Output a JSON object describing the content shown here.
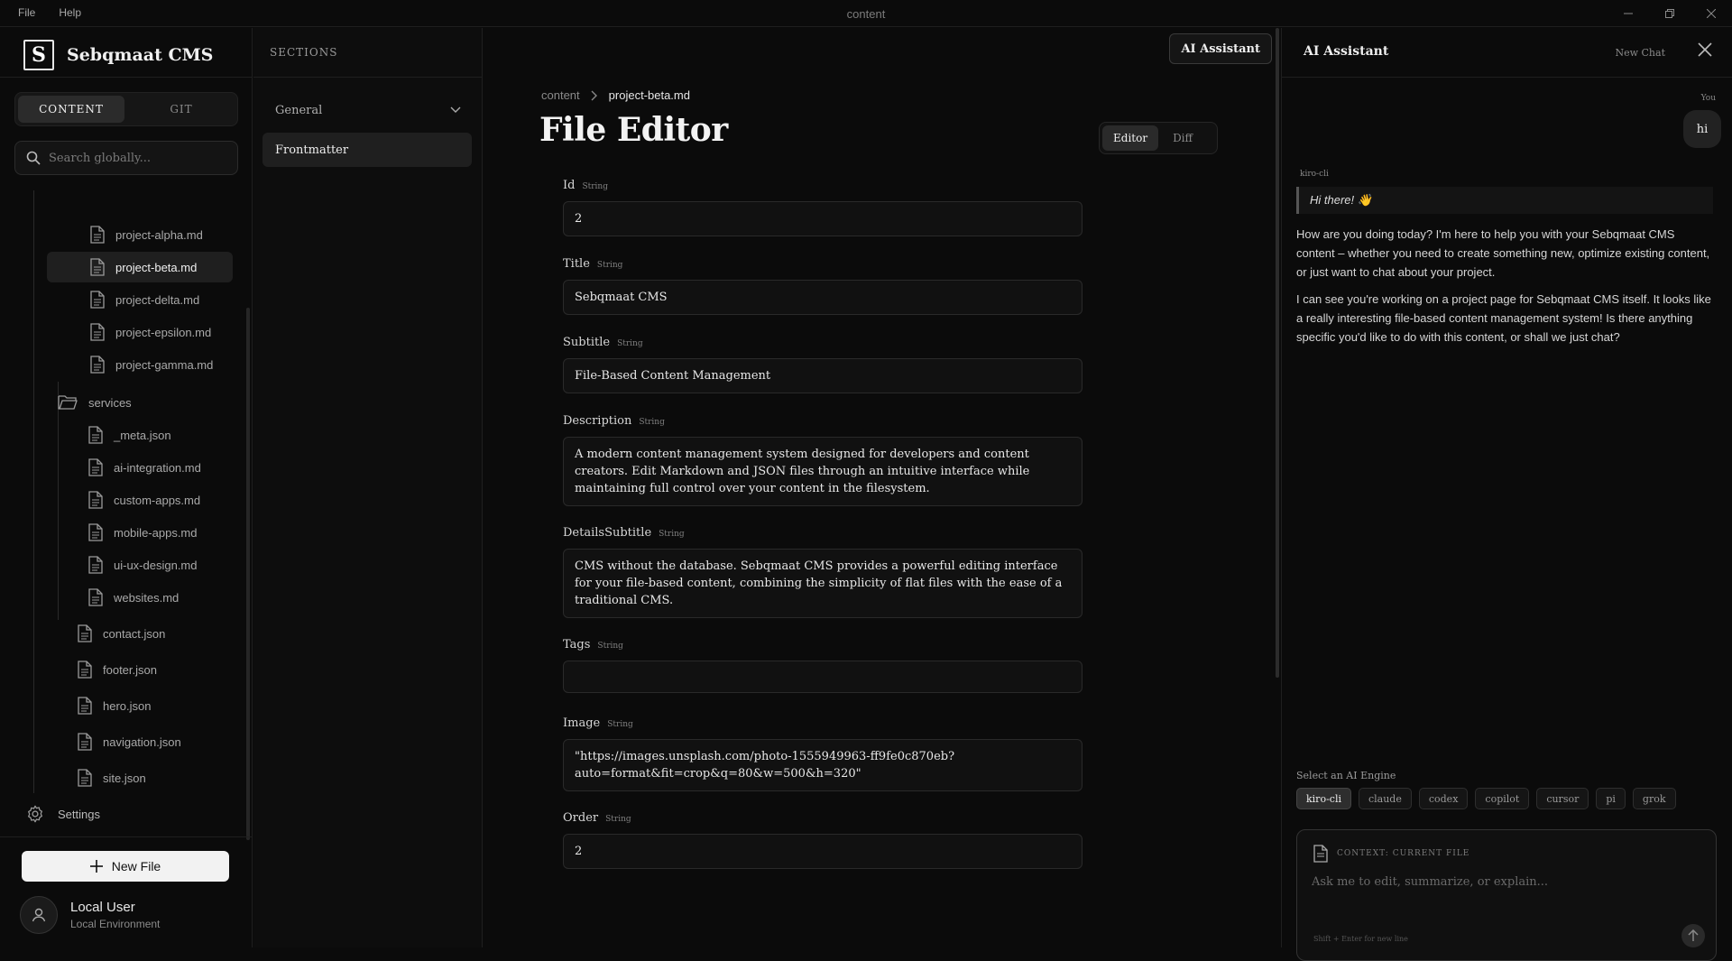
{
  "titlebar": {
    "menu": [
      "File",
      "Help"
    ],
    "title": "content"
  },
  "sidebar": {
    "brand": "Sebqmaat CMS",
    "tabs": [
      {
        "label": "CONTENT",
        "active": true
      },
      {
        "label": "GIT",
        "active": false
      }
    ],
    "search_placeholder": "Search globally...",
    "files_top": [
      "project-alpha.md",
      "project-beta.md",
      "project-delta.md",
      "project-epsilon.md",
      "project-gamma.md"
    ],
    "folder": "services",
    "services_files": [
      "_meta.json",
      "ai-integration.md",
      "custom-apps.md",
      "mobile-apps.md",
      "ui-ux-design.md",
      "websites.md"
    ],
    "root_files": [
      "contact.json",
      "footer.json",
      "hero.json",
      "navigation.json",
      "site.json"
    ],
    "settings": "Settings",
    "new_file": "New File",
    "user": {
      "name": "Local User",
      "env": "Local Environment"
    }
  },
  "sections": {
    "heading": "SECTIONS",
    "group": "General",
    "item": "Frontmatter"
  },
  "editor": {
    "ai_button": "AI Assistant",
    "breadcrumb": [
      "content",
      "project-beta.md"
    ],
    "title": "File Editor",
    "modes": [
      "Editor",
      "Diff"
    ],
    "fields": [
      {
        "label": "Id",
        "type": "String",
        "value": "2"
      },
      {
        "label": "Title",
        "type": "String",
        "value": "Sebqmaat CMS"
      },
      {
        "label": "Subtitle",
        "type": "String",
        "value": "File-Based Content Management"
      },
      {
        "label": "Description",
        "type": "String",
        "value": "A modern content management system designed for developers and content creators. Edit Markdown and JSON files through an intuitive interface while maintaining full control over your content in the filesystem."
      },
      {
        "label": "DetailsSubtitle",
        "type": "String",
        "value": "CMS  without the database. Sebqmaat CMS provides a powerful editing interface for your file-based content, combining the simplicity of flat files with the ease of a traditional CMS."
      },
      {
        "label": "Tags",
        "type": "String",
        "value": ""
      },
      {
        "label": "Image",
        "type": "String",
        "value": "\"https://images.unsplash.com/photo-1555949963-ff9fe0c870eb?auto=format&fit=crop&q=80&w=500&h=320\""
      },
      {
        "label": "Order",
        "type": "String",
        "value": "2"
      }
    ]
  },
  "ai": {
    "title": "AI Assistant",
    "new_chat": "New Chat",
    "you_label": "You",
    "you_message": "hi",
    "bot_label": "kiro-cli",
    "bot_greeting": "Hi there! 👋",
    "bot_paragraphs": [
      "How are you doing today? I'm here to help you with your Sebqmaat CMS content – whether you need to create something new, optimize existing content, or just want to chat about your project.",
      "I can see you're working on a project page for Sebqmaat CMS itself. It looks like a really interesting file-based content management system! Is there anything specific you'd like to do with this content, or shall we just chat?"
    ],
    "engine_label": "Select an AI Engine",
    "engines": [
      "kiro-cli",
      "claude",
      "codex",
      "copilot",
      "cursor",
      "pi",
      "grok"
    ],
    "active_engine": "kiro-cli",
    "context_label": "CONTEXT: CURRENT FILE",
    "input_placeholder": "Ask me to edit, summarize, or explain...",
    "hint": "Shift + Enter for new line"
  }
}
